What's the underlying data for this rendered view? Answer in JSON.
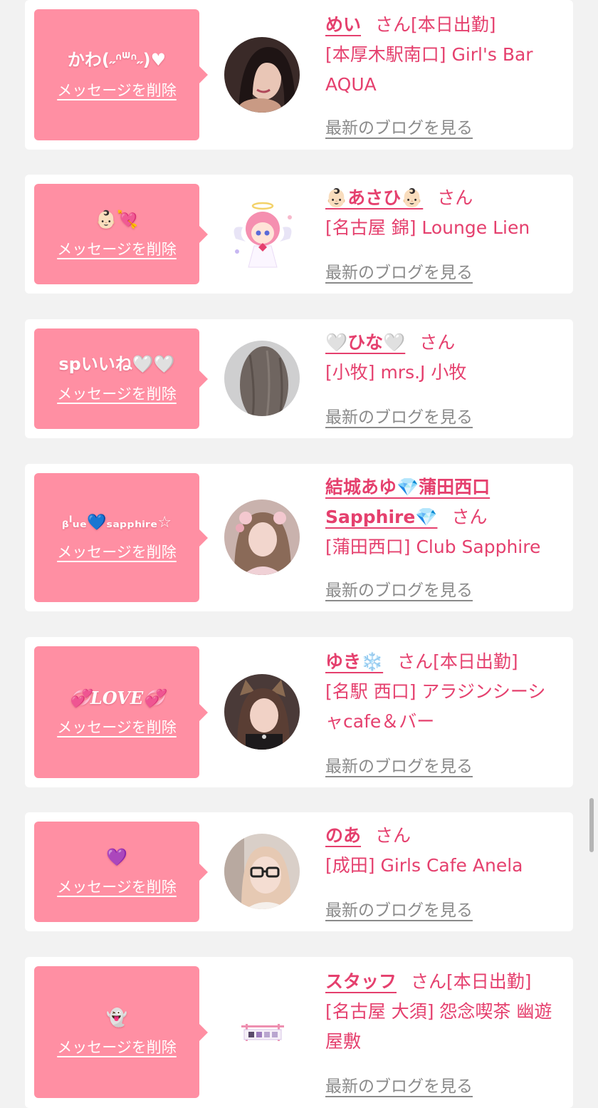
{
  "colors": {
    "background": "#f2f2f2",
    "card": "#ffffff",
    "bubble": "#ff8fa3",
    "accent": "#e5406e",
    "link_gray": "#8a8a8a"
  },
  "common": {
    "delete_label": "メッセージを削除",
    "san": "さん",
    "blog_link": "最新のブログを見る"
  },
  "messages": [
    {
      "text": "かわ(˶ᐢᐜᐢ˶)♥",
      "name": "めい",
      "badge": "[本日出勤]",
      "shop": "[本厚木駅南口] Girl's Bar AQUA",
      "avatar": "photo-woman-dark-hair-icon"
    },
    {
      "text": "👶🏻💘",
      "name": "👶🏻あさひ👶🏻",
      "badge": "",
      "shop": "[名古屋 錦] Lounge Lien",
      "avatar": "angel-illustration-icon"
    },
    {
      "text": "spいいね🤍🤍",
      "name": "🤍ひな🤍",
      "badge": "",
      "shop": "[小牧] mrs.J 小牧",
      "avatar": "photo-hair-back-icon"
    },
    {
      "text": "ᵦˡᵤₑ💙ₛₐₚₚₕᵢᵣₑ☆",
      "name": "結城あゆ💎蒲田西口Sapphire💎",
      "badge": "",
      "shop": "[蒲田西口] Club Sapphire",
      "avatar": "photo-woman-flowers-icon"
    },
    {
      "text": "💞LOVE💞",
      "name": "ゆき❄️",
      "badge": "[本日出勤]",
      "shop": "[名駅 西口] アラジンシーシャcafe＆バー",
      "avatar": "photo-woman-cat-ears-icon"
    },
    {
      "text": "💜",
      "name": "のあ",
      "badge": "",
      "shop": "[成田] Girls Cafe Anela",
      "avatar": "photo-woman-glasses-icon"
    },
    {
      "text": "👻",
      "name": "スタッフ",
      "badge": "[本日出勤]",
      "shop": "[名古屋 大須] 怨念喫茶 幽遊屋敷",
      "avatar": "shop-logo-icon"
    }
  ]
}
